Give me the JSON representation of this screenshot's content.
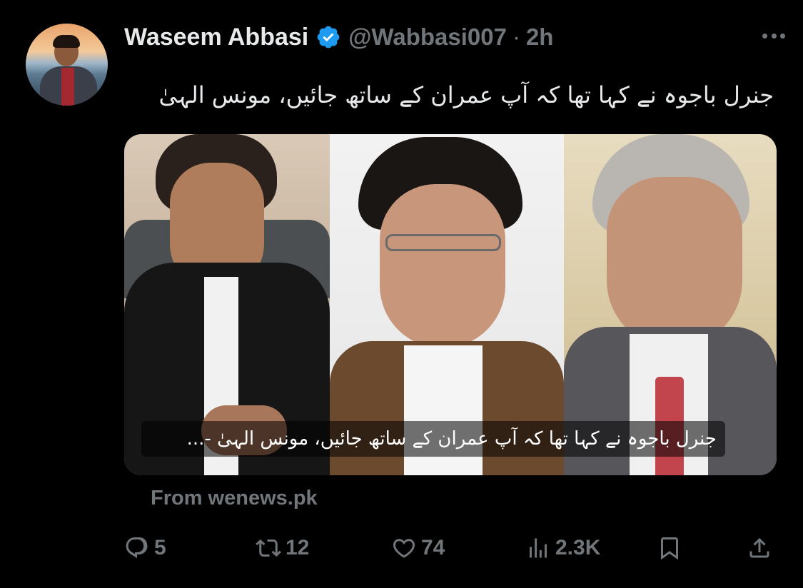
{
  "author": {
    "display_name": "Waseem Abbasi",
    "handle": "@Wabbasi007",
    "separator": "·",
    "time": "2h",
    "verified": true,
    "verified_color": "#1d9bf0"
  },
  "tweet": {
    "text": "جنرل باجوہ نے کہا تھا کہ آپ عمران کے ساتھ جائیں، مونس الہیٰ"
  },
  "media": {
    "caption": "جنرل باجوہ نے کہا تھا کہ آپ عمران کے ساتھ جائیں، مونس الہیٰ -..."
  },
  "card": {
    "source": "From wenews.pk"
  },
  "actions": {
    "reply_icon": "reply-icon",
    "reply_count": "5",
    "retweet_icon": "retweet-icon",
    "retweet_count": "12",
    "like_icon": "heart-icon",
    "like_count": "74",
    "views_icon": "views-icon",
    "views_count": "2.3K",
    "bookmark_icon": "bookmark-icon",
    "share_icon": "share-icon"
  },
  "colors": {
    "background": "#000000",
    "text": "#e7e9ea",
    "muted": "#71767b",
    "accent": "#1d9bf0"
  }
}
